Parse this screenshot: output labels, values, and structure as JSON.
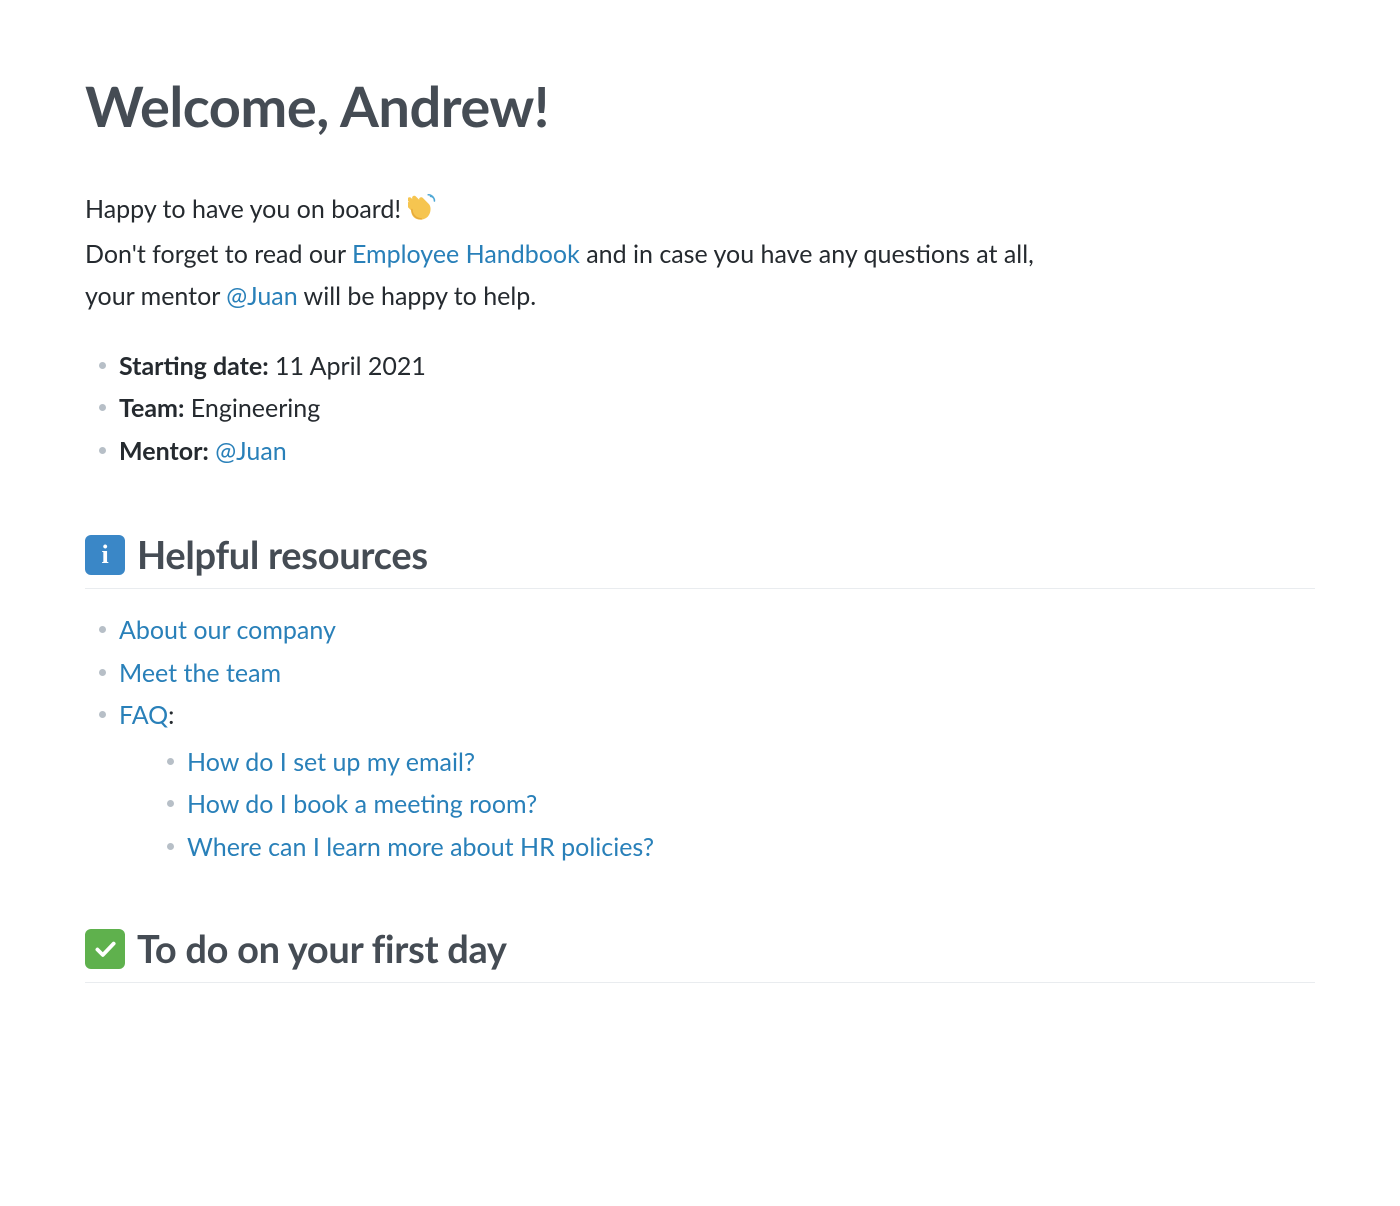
{
  "title": "Welcome, Andrew!",
  "intro": {
    "line1": "Happy to have you on board! ",
    "line2_pre": "Don't forget to read our ",
    "handbook_link": "Employee Handbook",
    "line2_mid": " and in case you have any questions at all, your mentor ",
    "mentor_mention": "@Juan",
    "line2_post": " will be happy to help."
  },
  "info": {
    "starting_date_label": "Starting date:",
    "starting_date_value": " 11 April 2021",
    "team_label": "Team:",
    "team_value": " Engineering",
    "mentor_label": "Mentor:",
    "mentor_value": "@Juan"
  },
  "sections": {
    "resources_heading": "Helpful resources",
    "todo_heading": "To do on your first day"
  },
  "resources": {
    "about": "About our company",
    "meet": "Meet the team",
    "faq": "FAQ",
    "faq_colon": ":",
    "faq_items": {
      "q1": "How do I set up my email?",
      "q2": "How do I book a meeting room?",
      "q3": "Where can I learn more about HR policies?"
    }
  }
}
